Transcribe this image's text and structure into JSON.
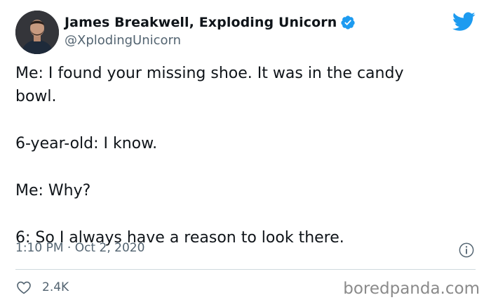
{
  "author": {
    "name": "James Breakwell, Exploding Unicorn",
    "handle": "@XplodingUnicorn",
    "verified": true,
    "avatar_icon": "profile-photo"
  },
  "tweet": {
    "lines": [
      "Me: I found your missing shoe. It was in the candy",
      "bowl.",
      "6-year-old: I know.",
      "Me: Why?",
      "6: So I always have a reason to look there."
    ],
    "time": "1:10 PM · Oct 2, 2020",
    "likes": "2.4K"
  },
  "icons": {
    "brand": "twitter-bird-icon",
    "verified": "verified-badge-icon",
    "info": "info-icon",
    "like": "heart-icon"
  },
  "colors": {
    "twitter_blue": "#1d9bf0",
    "text": "#0f1419",
    "secondary": "#536471",
    "divider": "#cfd9de"
  },
  "watermark": "boredpanda.com"
}
